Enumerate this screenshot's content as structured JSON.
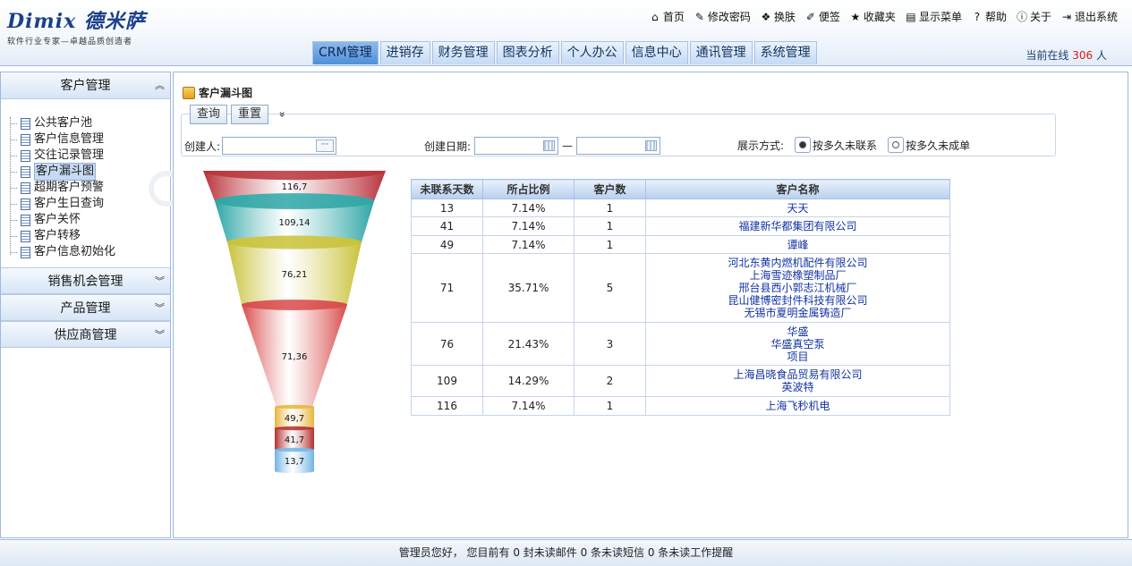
{
  "logo": {
    "brand": "Dimix 德米萨",
    "slogan": "软件行业专家—卓越品质创造者"
  },
  "toplinks": [
    {
      "label": "首页",
      "icon": "home-icon",
      "glyph": "⌂"
    },
    {
      "label": "修改密码",
      "icon": "key-icon",
      "glyph": "✎"
    },
    {
      "label": "换肤",
      "icon": "palette-icon",
      "glyph": "❖"
    },
    {
      "label": "便签",
      "icon": "note-icon",
      "glyph": "✐"
    },
    {
      "label": "收藏夹",
      "icon": "star-icon",
      "glyph": "★"
    },
    {
      "label": "显示菜单",
      "icon": "menu-icon",
      "glyph": "▤"
    },
    {
      "label": "帮助",
      "icon": "help-icon",
      "glyph": "?"
    },
    {
      "label": "关于",
      "icon": "info-icon",
      "glyph": "ⓘ"
    },
    {
      "label": "退出系统",
      "icon": "exit-icon",
      "glyph": "⇥"
    }
  ],
  "nav": {
    "tabs": [
      "CRM管理",
      "进销存",
      "财务管理",
      "图表分析",
      "个人办公",
      "信息中心",
      "通讯管理",
      "系统管理"
    ],
    "active": 0
  },
  "online": {
    "prefix": "当前在线",
    "count": "306",
    "suffix": "人"
  },
  "sidebar": {
    "customer_panel": "客户管理",
    "items": [
      "公共客户池",
      "客户信息管理",
      "交往记录管理",
      "客户漏斗图",
      "超期客户预警",
      "客户生日查询",
      "客户关怀",
      "客户转移",
      "客户信息初始化"
    ],
    "selected": 3,
    "other_panels": [
      "销售机会管理",
      "产品管理",
      "供应商管理"
    ]
  },
  "main": {
    "title": "客户漏斗图",
    "query_button": "查询",
    "reset_button": "重置",
    "expand_glyph": "»",
    "creator_label": "创建人:",
    "creator_value": "",
    "creator_btn": "···",
    "date_label": "创建日期:",
    "date_sep": "—",
    "date_from": "",
    "date_to": "",
    "display_label": "展示方式:",
    "radio1": "按多久未联系",
    "radio2": "按多久未成单"
  },
  "chart_data": {
    "type": "funnel",
    "labels": [
      "116,7",
      "109,14",
      "76,21",
      "71,36",
      "49,7",
      "41,7",
      "13,7"
    ],
    "values": [
      7.14,
      14.29,
      21.43,
      35.71,
      7.14,
      7.14,
      7.14
    ],
    "colors": [
      "#b8323a",
      "#2ea6a6",
      "#c9c23a",
      "#d94a4a",
      "#e8b53a",
      "#b33030",
      "#6fb4e6"
    ]
  },
  "table": {
    "headers": [
      "未联系天数",
      "所占比例",
      "客户数",
      "客户名称"
    ],
    "rows": [
      {
        "days": "13",
        "pct": "7.14%",
        "count": "1",
        "names": [
          "天天"
        ]
      },
      {
        "days": "41",
        "pct": "7.14%",
        "count": "1",
        "names": [
          "福建新华都集团有限公司"
        ]
      },
      {
        "days": "49",
        "pct": "7.14%",
        "count": "1",
        "names": [
          "谭峰"
        ]
      },
      {
        "days": "71",
        "pct": "35.71%",
        "count": "5",
        "names": [
          "河北东黄内燃机配件有限公司",
          "上海雪迹橡塑制品厂",
          "邢台县西小郭志江机械厂",
          "昆山健博密封件科技有限公司",
          "无锡市夏明金属铸造厂"
        ]
      },
      {
        "days": "76",
        "pct": "21.43%",
        "count": "3",
        "names": [
          "华盛",
          "华盛真空泵",
          "项目"
        ]
      },
      {
        "days": "109",
        "pct": "14.29%",
        "count": "2",
        "names": [
          "上海昌晓食品贸易有限公司",
          "英波特"
        ]
      },
      {
        "days": "116",
        "pct": "7.14%",
        "count": "1",
        "names": [
          "上海飞秒机电"
        ]
      }
    ]
  },
  "footer": {
    "text": "管理员您好，  您目前有  0 封未读邮件   0 条未读短信   0 条未读工作提醒"
  }
}
